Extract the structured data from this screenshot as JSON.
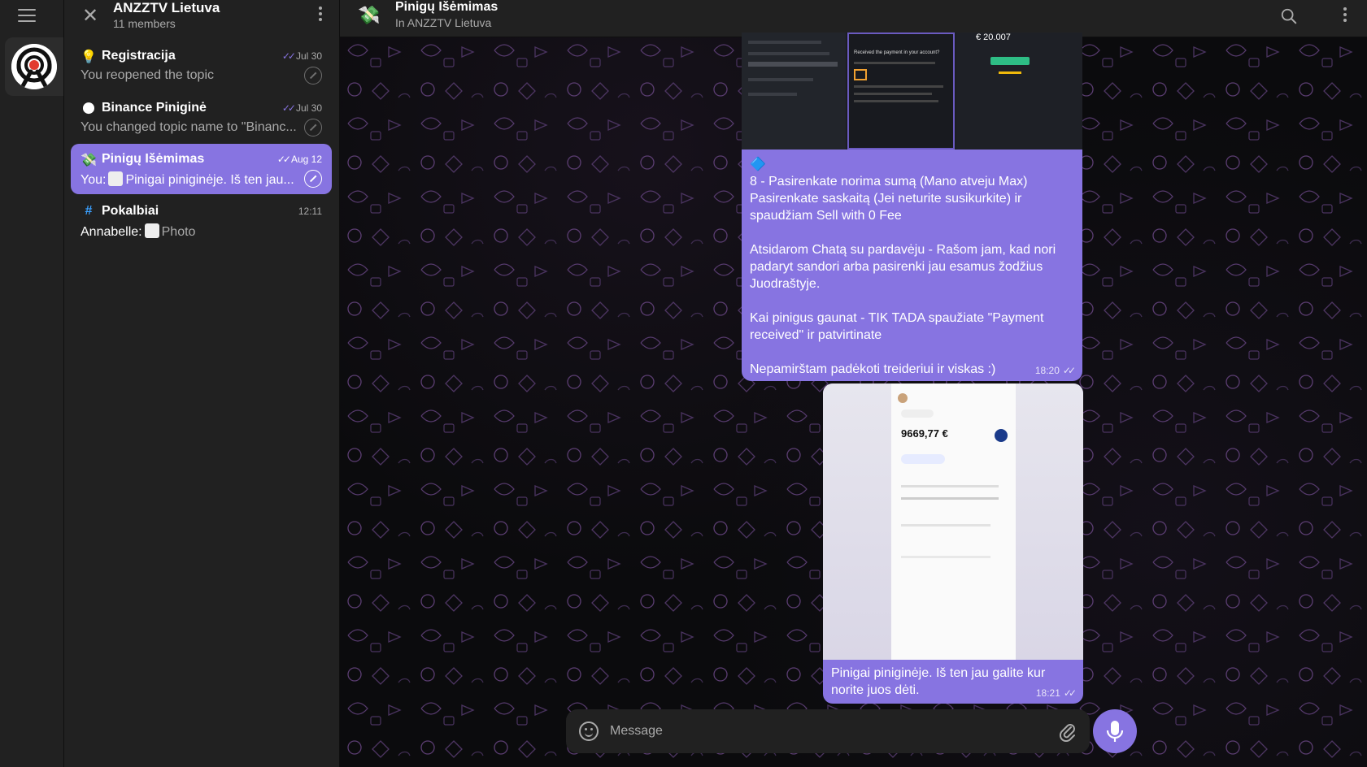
{
  "rail": {
    "menu_icon": "hamburger-icon",
    "channel_logo": "anzztv-logo"
  },
  "group": {
    "title": "ANZZTV Lietuva",
    "members": "11 members"
  },
  "topics": [
    {
      "icon": "💡",
      "name": "Registracija",
      "date": "Jul 30",
      "message": "You reopened the topic",
      "read": true
    },
    {
      "icon": "🌑",
      "name": "Binance Piniginė",
      "date": "Jul 30",
      "message": "You changed topic name to \"Binanc...",
      "read": true
    },
    {
      "icon": "💸",
      "name": "Pinigų Išėmimas",
      "date": "Aug 12",
      "message_prefix": "You:",
      "message": "Pinigai piniginėje. Iš ten jau...",
      "read": true,
      "active": true
    },
    {
      "icon": "#",
      "name": "Pokalbiai",
      "date": "12:11",
      "message_prefix": "Annabelle:",
      "message": "Photo"
    }
  ],
  "chat": {
    "title": "Pinigų Išėmimas",
    "subtitle": "In ANZZTV Lietuva"
  },
  "messages": [
    {
      "text": "🔷\n8 - Pasirenkate norima sumą (Mano atveju Max)\nPasirenkate saskaitą (Jei neturite susikurkite) ir spaudžiam Sell with 0 Fee\n\nAtsidarom Chatą su pardavėju - Rašom jam, kad nori padaryt sandori arba pasirenki jau esamus žodžius Juodraštyje.\n\nKai pinigus gaunat - TIK TADA spaužiate \"Payment received\" ir patvirtinate\n\nNepamirštam padėkoti treideriui ir viskas :)",
      "time": "18:20",
      "screenshot": {
        "amount": "€ 20.007",
        "heading": "Received the payment in your account?"
      }
    },
    {
      "text": "Pinigai piniginėje. Iš ten jau galite kur norite juos dėti.",
      "time": "18:21",
      "photo": {
        "balance": "9669,77 €"
      }
    }
  ],
  "composer": {
    "placeholder": "Message"
  },
  "colors": {
    "accent": "#8774e1",
    "panel": "#212121",
    "muted": "#aaaaaa"
  }
}
